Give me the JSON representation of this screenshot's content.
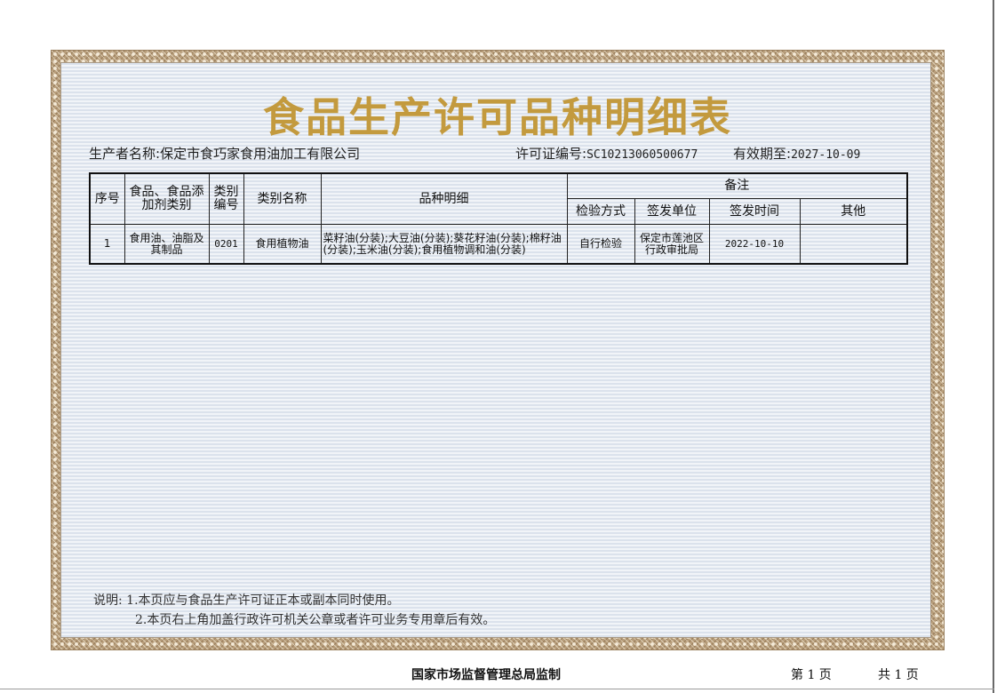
{
  "document": {
    "title": "食品生产许可品种明细表",
    "producer_label": "生产者名称:",
    "producer_name": "保定市食巧家食用油加工有限公司",
    "license_label": "许可证编号:",
    "license_no": "SC10213060500677",
    "valid_label": "有效期至:",
    "valid_until": "2027-10-09"
  },
  "table": {
    "headers": {
      "seq": "序号",
      "food_category": "食品、食品添加剂类别",
      "category_code": "类别编号",
      "category_name": "类别名称",
      "variety_detail": "品种明细",
      "remarks": "备注",
      "inspection_method": "检验方式",
      "issuing_unit": "签发单位",
      "issue_date": "签发时间",
      "other": "其他"
    },
    "rows": [
      {
        "seq": "1",
        "food_category": "食用油、油脂及其制品",
        "category_code": "0201",
        "category_name": "食用植物油",
        "variety_detail": "菜籽油(分装);大豆油(分装);葵花籽油(分装);棉籽油(分装);玉米油(分装);食用植物调和油(分装)",
        "inspection_method": "自行检验",
        "issuing_unit": "保定市莲池区行政审批局",
        "issue_date": "2022-10-10",
        "other": ""
      }
    ]
  },
  "notes": {
    "label": "说明:",
    "line1": "1.本页应与食品生产许可证正本或副本同时使用。",
    "line2": "2.本页右上角加盖行政许可机关公章或者许可业务专用章后有效。"
  },
  "footer": {
    "authority": "国家市场监督管理总局监制",
    "page": "第 1 页",
    "total": "共 1 页"
  }
}
